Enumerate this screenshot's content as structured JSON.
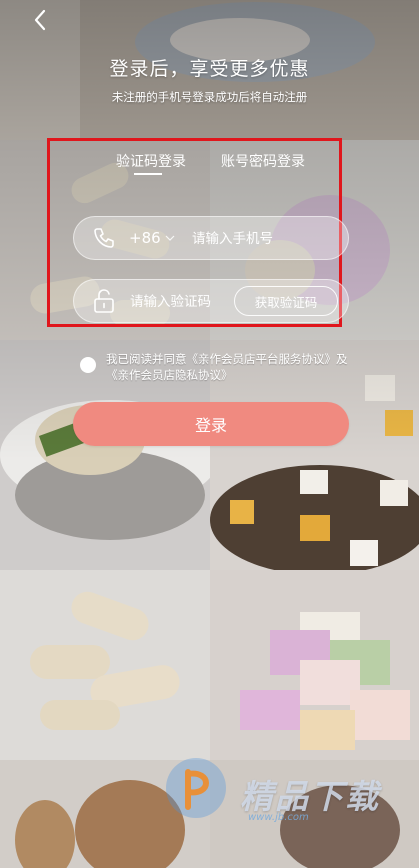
{
  "header": {
    "back_icon": "chevron-left-icon",
    "headline": "登录后，享受更多优惠",
    "subline": "未注册的手机号登录成功后将自动注册"
  },
  "tabs": [
    {
      "label": "验证码登录",
      "active": true
    },
    {
      "label": "账号密码登录",
      "active": false
    }
  ],
  "phone_field": {
    "icon": "phone-icon",
    "country_code": "+86",
    "placeholder": "请输入手机号",
    "value": ""
  },
  "code_field": {
    "icon": "lock-icon",
    "placeholder": "请输入验证码",
    "value": "",
    "get_code_label": "获取验证码"
  },
  "agreement": {
    "prefix": "我已阅读并同意",
    "service_link": "《亲作会员店平台服务协议》",
    "and": "及",
    "privacy_link": "《亲作会员店隐私协议》",
    "checked": false
  },
  "login_button": {
    "label": "登录"
  },
  "watermark": {
    "text": "精品下载",
    "sub": "www.jb.com"
  },
  "colors": {
    "login_button": "#f08a80",
    "highlight_border": "#e0161c",
    "text": "#ffffff"
  }
}
